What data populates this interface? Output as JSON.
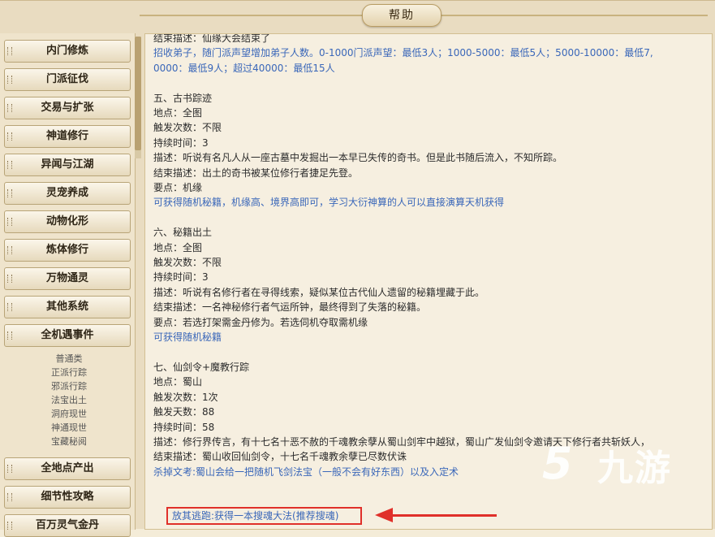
{
  "window": {
    "title": "帮助"
  },
  "sidebar": {
    "items": [
      "内门修炼",
      "门派征伐",
      "交易与扩张",
      "神道修行",
      "异闻与江湖",
      "灵宠养成",
      "动物化形",
      "炼体修行",
      "万物通灵",
      "其他系统",
      "全机遇事件"
    ],
    "sub_items": [
      "普通类",
      "正派行踪",
      "邪派行踪",
      "法宝出土",
      "洞府现世",
      "神通现世",
      "宝藏秘阅"
    ],
    "bottom_items": [
      "全地点产出",
      "细节性攻略",
      "百万灵气金丹"
    ]
  },
  "content": {
    "lines": [
      {
        "text": "结束描述：仙缘大会结束了",
        "cls": "top-partial"
      },
      {
        "text": "招收弟子，随门派声望增加弟子人数。0-1000门派声望：最低3人；1000-5000：最低5人；5000-10000：最低7,",
        "cls": "blue"
      },
      {
        "text": "0000：最低9人；超过40000：最低15人",
        "cls": "blue"
      },
      {
        "text": "",
        "cls": "gap"
      },
      {
        "text": "五、古书踪迹",
        "cls": ""
      },
      {
        "text": "地点：全图",
        "cls": ""
      },
      {
        "text": "触发次数：不限",
        "cls": ""
      },
      {
        "text": "持续时间：3",
        "cls": ""
      },
      {
        "text": "描述：听说有名凡人从一座古墓中发掘出一本早已失传的奇书。但是此书随后流入，不知所踪。",
        "cls": ""
      },
      {
        "text": "结束描述：出土的奇书被某位修行者捷足先登。",
        "cls": ""
      },
      {
        "text": "要点：机缘",
        "cls": ""
      },
      {
        "text": "可获得随机秘籍，机缘高、境界高即可，学习大衍神算的人可以直接演算天机获得",
        "cls": "blue"
      },
      {
        "text": "",
        "cls": "gap"
      },
      {
        "text": "六、秘籍出土",
        "cls": ""
      },
      {
        "text": "地点：全图",
        "cls": ""
      },
      {
        "text": "触发次数：不限",
        "cls": ""
      },
      {
        "text": "持续时间：3",
        "cls": ""
      },
      {
        "text": "描述：听说有名修行者在寻得线索，疑似某位古代仙人遗留的秘籍埋藏于此。",
        "cls": ""
      },
      {
        "text": "结束描述：一名神秘修行者气运所钟，最终得到了失落的秘籍。",
        "cls": ""
      },
      {
        "text": "要点：若选打架需金丹修为。若选伺机夺取需机缘",
        "cls": ""
      },
      {
        "text": "可获得随机秘籍",
        "cls": "blue"
      },
      {
        "text": "",
        "cls": "gap"
      },
      {
        "text": "七、仙剑令+魔教行踪",
        "cls": ""
      },
      {
        "text": "地点：蜀山",
        "cls": ""
      },
      {
        "text": "触发次数：1次",
        "cls": ""
      },
      {
        "text": "触发天数：88",
        "cls": ""
      },
      {
        "text": "持续时间：58",
        "cls": ""
      },
      {
        "text": "描述：修行界传言，有十七名十恶不赦的千魂教余孽从蜀山剑牢中越狱，蜀山广发仙剑令邀请天下修行者共斩妖人，",
        "cls": ""
      },
      {
        "text": "结束描述：蜀山收回仙剑令，十七名千魂教余孽已尽数伏诛",
        "cls": ""
      },
      {
        "text": "杀掉文考:蜀山会给一把随机飞剑法宝（一般不会有好东西）以及入定术",
        "cls": "blue"
      }
    ],
    "highlight": "放其逃跑:获得一本搜魂大法(推荐搜魂)"
  },
  "watermark": {
    "logo": "5",
    "text": "九游"
  }
}
